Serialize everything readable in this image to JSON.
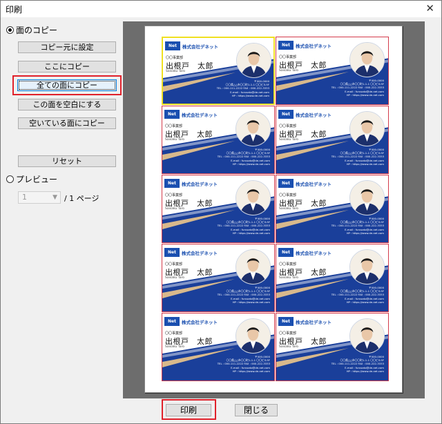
{
  "window": {
    "title": "印刷",
    "close_glyph": "✕"
  },
  "left_panel": {
    "radio_copy_label": "面のコピー",
    "buttons": {
      "set_source": "コピー元に設定",
      "copy_here": "ここにコピー",
      "copy_to_all": "全ての面にコピー",
      "make_blank": "この面を空白にする",
      "copy_to_empty": "空いている面にコピー",
      "reset": "リセット"
    },
    "radio_preview_label": "プレビュー",
    "page_select": {
      "value": "1"
    },
    "page_total": "/ 1 ページ"
  },
  "card": {
    "logo_text": "Net",
    "company": "株式会社デネット",
    "department": "〇〇事業部",
    "name": "出根戸　太郎",
    "roman": "Saisaku Taro",
    "address_lines": [
      "〒000-0000",
      "〇〇県△△市〇〇町1-1-1 〇〇ビル5F",
      "TEL : 000-111-2222  FAX : 000-222-3333",
      "E-mail : furusato@de-net.com",
      "HP : https://www.de-net.com"
    ],
    "colors": {
      "blue": "#1a3f9a",
      "accent": "#d8b98c"
    }
  },
  "footer": {
    "print_button": "印刷",
    "close_button": "閉じる"
  },
  "highlight_color": "#e0202a"
}
